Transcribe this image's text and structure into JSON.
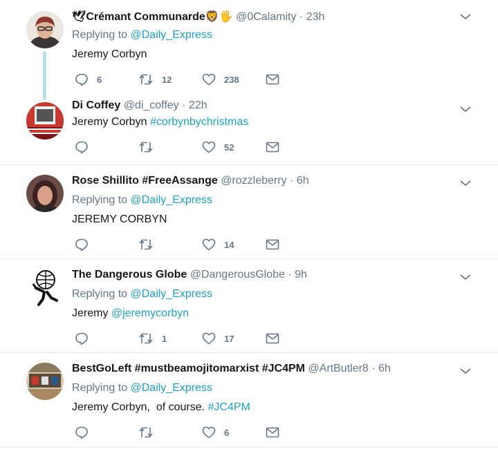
{
  "tweets": [
    {
      "name": "🕊Crémant Communarde🦁🖐",
      "handle": "@0Calamity",
      "time": "· 23h",
      "reply_prefix": "Replying to",
      "reply_user": "@Daily_Express",
      "text": "Jeremy Corbyn",
      "text_link": "",
      "reply_count": "6",
      "retweet_count": "12",
      "like_count": "238"
    },
    {
      "name": "Di Coffey",
      "handle": "@di_coffey",
      "time": "· 22h",
      "text": "Jeremy Corbyn",
      "text_link": "#corbynbychristmas",
      "reply_count": "",
      "retweet_count": "",
      "like_count": "52"
    },
    {
      "name": "Rose Shillito #FreeAssange",
      "handle": "@rozzleberry",
      "time": "· 6h",
      "reply_prefix": "Replying to",
      "reply_user": "@Daily_Express",
      "text": "JEREMY CORBYN",
      "text_link": "",
      "reply_count": "",
      "retweet_count": "",
      "like_count": "14"
    },
    {
      "name": "The Dangerous Globe",
      "handle": "@DangerousGlobe",
      "time": "· 9h",
      "reply_prefix": "Replying to",
      "reply_user": "@Daily_Express",
      "text": "Jeremy",
      "text_link": "@jeremycorbyn",
      "reply_count": "",
      "retweet_count": "1",
      "like_count": "17"
    },
    {
      "name": "BestGoLeft #mustbeamojitomarxist #JC4PM",
      "handle": "@ArtButler8",
      "time": "· 6h",
      "reply_prefix": "Replying to",
      "reply_user": "@Daily_Express",
      "text": "Jeremy Corbyn,  of course.",
      "text_link": "#JC4PM",
      "reply_count": "",
      "retweet_count": "",
      "like_count": "6"
    }
  ],
  "colors": {
    "link": "#1da1c8",
    "meta": "#657786",
    "separator": "#e6ecf0",
    "thread_line": "#b6dfe6"
  }
}
